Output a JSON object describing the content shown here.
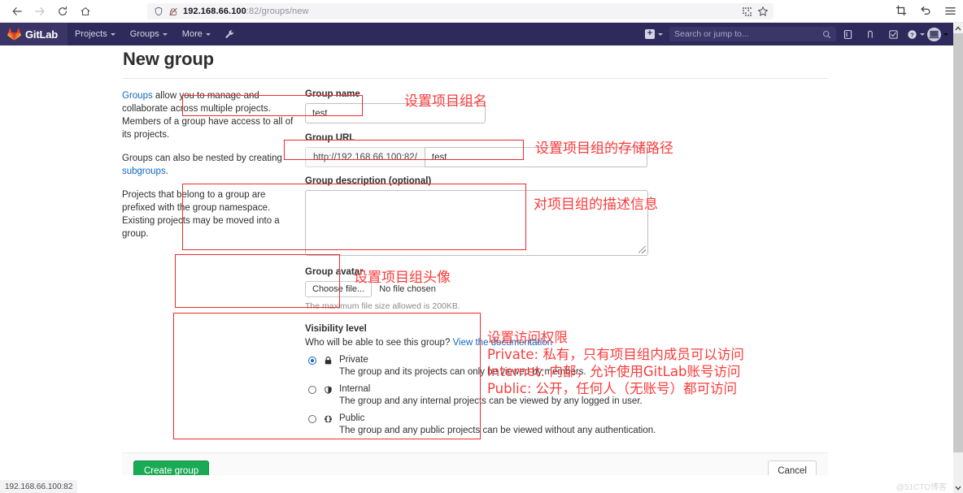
{
  "browser": {
    "back_icon": "back-arrow-icon",
    "forward_icon": "forward-arrow-icon",
    "reload_icon": "reload-icon",
    "home_icon": "home-icon",
    "url_main": "192.168.66.100",
    "url_dim": ":82/groups/new",
    "shield_icon": "shield-icon",
    "permission_icon": "blocked-permission-icon",
    "qr_icon": "qr-code-icon",
    "bookmark_icon": "star-bookmark-icon",
    "screenshot_icon": "screenshot-icon",
    "undo_icon": "undo-arrow-icon",
    "menu_icon": "hamburger-menu-icon"
  },
  "gitlab_nav": {
    "logo_text": "GitLab",
    "logo_icon": "gitlab-tanuki-icon",
    "items": [
      {
        "label": "Projects",
        "name": "nav-projects"
      },
      {
        "label": "Groups",
        "name": "nav-groups"
      },
      {
        "label": "More",
        "name": "nav-more"
      }
    ],
    "wrench_icon": "admin-wrench-icon",
    "plus_label": "+",
    "search_placeholder": "Search or jump to...",
    "search_icon": "search-icon",
    "issues_icon": "issues-icon",
    "merge_requests_icon": "merge-request-icon",
    "todos_icon": "todos-checkbox-icon",
    "help_icon": "help-question-icon",
    "avatar_icon": "user-avatar-icon"
  },
  "page": {
    "title": "New group",
    "intro": [
      {
        "link": "Groups",
        "text": " allow you to manage and collaborate across multiple projects. Members of a group have access to all of its projects."
      },
      {
        "pre": "Groups can also be nested by creating ",
        "link": "subgroups",
        "post": "."
      },
      {
        "text": "Projects that belong to a group are prefixed with the group namespace. Existing projects may be moved into a group."
      }
    ]
  },
  "form": {
    "group_name_label": "Group name",
    "group_name_value": "test",
    "group_url_label": "Group URL",
    "group_url_prefix": "http://192.168.66.100:82/",
    "group_url_value": "test",
    "group_desc_label": "Group description (optional)",
    "group_desc_value": "",
    "avatar_label": "Group avatar",
    "choose_file_label": "Choose file...",
    "no_file_label": "No file chosen",
    "avatar_hint": "The maximum file size allowed is 200KB.",
    "visibility_label": "Visibility level",
    "visibility_question": "Who will be able to see this group?",
    "visibility_doc_link": "View the documentation",
    "visibility_options": [
      {
        "name": "Private",
        "icon": "lock-icon",
        "desc": "The group and its projects can only be viewed by members.",
        "selected": true
      },
      {
        "name": "Internal",
        "icon": "shield-icon",
        "desc": "The group and any internal projects can be viewed by any logged in user.",
        "selected": false
      },
      {
        "name": "Public",
        "icon": "globe-icon",
        "desc": "The group and any public projects can be viewed without any authentication.",
        "selected": false
      }
    ],
    "create_button": "Create group",
    "cancel_button": "Cancel"
  },
  "annotations": {
    "color": "#fb3b3b",
    "group_name": "设置项目组名",
    "group_url": "设置项目组的存储路径",
    "group_desc": "对项目组的描述信息",
    "group_avatar": "设置项目组头像",
    "visibility_line1": "设置访问权限",
    "visibility_line2": "Private: 私有，只有项目组内成员可以访问",
    "visibility_line3": "Internet: 内部，允许使用GitLab账号访问",
    "visibility_line4": "Public: 公开，任何人（无账号）都可访问"
  },
  "status": {
    "link_preview": "192.168.66.100:82",
    "watermark": "@51CTO博客"
  }
}
